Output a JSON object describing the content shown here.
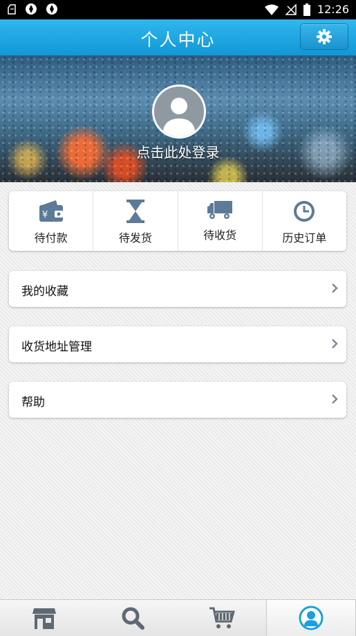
{
  "status_bar": {
    "time": "12:26",
    "icons": [
      "notification-icon",
      "app-icon",
      "app-icon",
      "wifi-icon",
      "no-signal-icon",
      "battery-icon"
    ]
  },
  "header": {
    "title": "个人中心",
    "settings_icon": "gear-icon",
    "accent_color": "#1fa8e3"
  },
  "profile": {
    "login_text": "点击此处登录",
    "avatar_icon": "user-avatar-icon"
  },
  "orders": [
    {
      "label": "待付款",
      "icon": "wallet-icon"
    },
    {
      "label": "待发货",
      "icon": "hourglass-icon"
    },
    {
      "label": "待收货",
      "icon": "truck-icon"
    },
    {
      "label": "历史订单",
      "icon": "clock-icon"
    }
  ],
  "menu": [
    {
      "label": "我的收藏"
    },
    {
      "label": "收货地址管理"
    },
    {
      "label": "帮助"
    }
  ],
  "tabbar": {
    "tabs": [
      {
        "icon": "store-icon"
      },
      {
        "icon": "search-icon"
      },
      {
        "icon": "cart-icon"
      },
      {
        "icon": "profile-icon",
        "active": true
      }
    ]
  }
}
